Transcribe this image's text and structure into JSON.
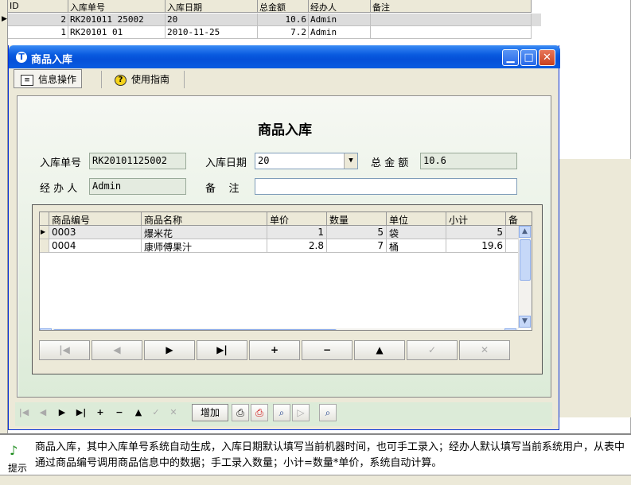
{
  "background_grid": {
    "headers": [
      "ID",
      "入库单号",
      "入库日期",
      "总金额",
      "经办人",
      "备注"
    ],
    "rows": [
      {
        "id": "2",
        "no": "RK201011 25002",
        "date": "20",
        "amount": "10.6",
        "handler": "Admin",
        "note": ""
      },
      {
        "id": "1",
        "no": "RK20101  01",
        "date": "2010-11-25",
        "amount": "7.2",
        "handler": "Admin",
        "note": ""
      }
    ]
  },
  "window": {
    "title": "商品入库",
    "tabs": [
      "信息操作",
      "使用指南"
    ],
    "form_title": "商品入库",
    "fields": {
      "order_no_label": "入库单号",
      "order_no_value": "RK20101125002",
      "date_label": "入库日期",
      "date_value": "20",
      "total_label": "总 金 额",
      "total_value": "10.6",
      "handler_label": "经 办 人",
      "handler_value": "Admin",
      "note_label": "备    注",
      "note_value": ""
    },
    "grid": {
      "headers": [
        "商品编号",
        "商品名称",
        "单价",
        "数量",
        "单位",
        "小计",
        "备"
      ],
      "rows": [
        {
          "code": "0003",
          "name": "爆米花",
          "price": "1",
          "qty": "5",
          "unit": "袋",
          "subtotal": "5"
        },
        {
          "code": "0004",
          "name": "康师傅果汁",
          "price": "2.8",
          "qty": "7",
          "unit": "桶",
          "subtotal": "19.6"
        }
      ]
    },
    "nav_buttons": [
      "|◀",
      "◀",
      "▶",
      "▶|",
      "+",
      "−",
      "▲",
      "✓",
      "✕"
    ],
    "bottom_toolbar": {
      "nav": [
        "|◀",
        "◀",
        "▶",
        "▶|",
        "+",
        "−",
        "▲",
        "✓",
        "✕"
      ],
      "add_label": "增加"
    }
  },
  "status": {
    "tip_label": "提示",
    "text": "商品入库，其中入库单号系统自动生成，入库日期默认填写当前机器时间，也可手工录入；经办人默认填写当前系统用户，从表中通过商品编号调用商品信息中的数据；手工录入数量；小计=数量*单价，系统自动计算。"
  }
}
